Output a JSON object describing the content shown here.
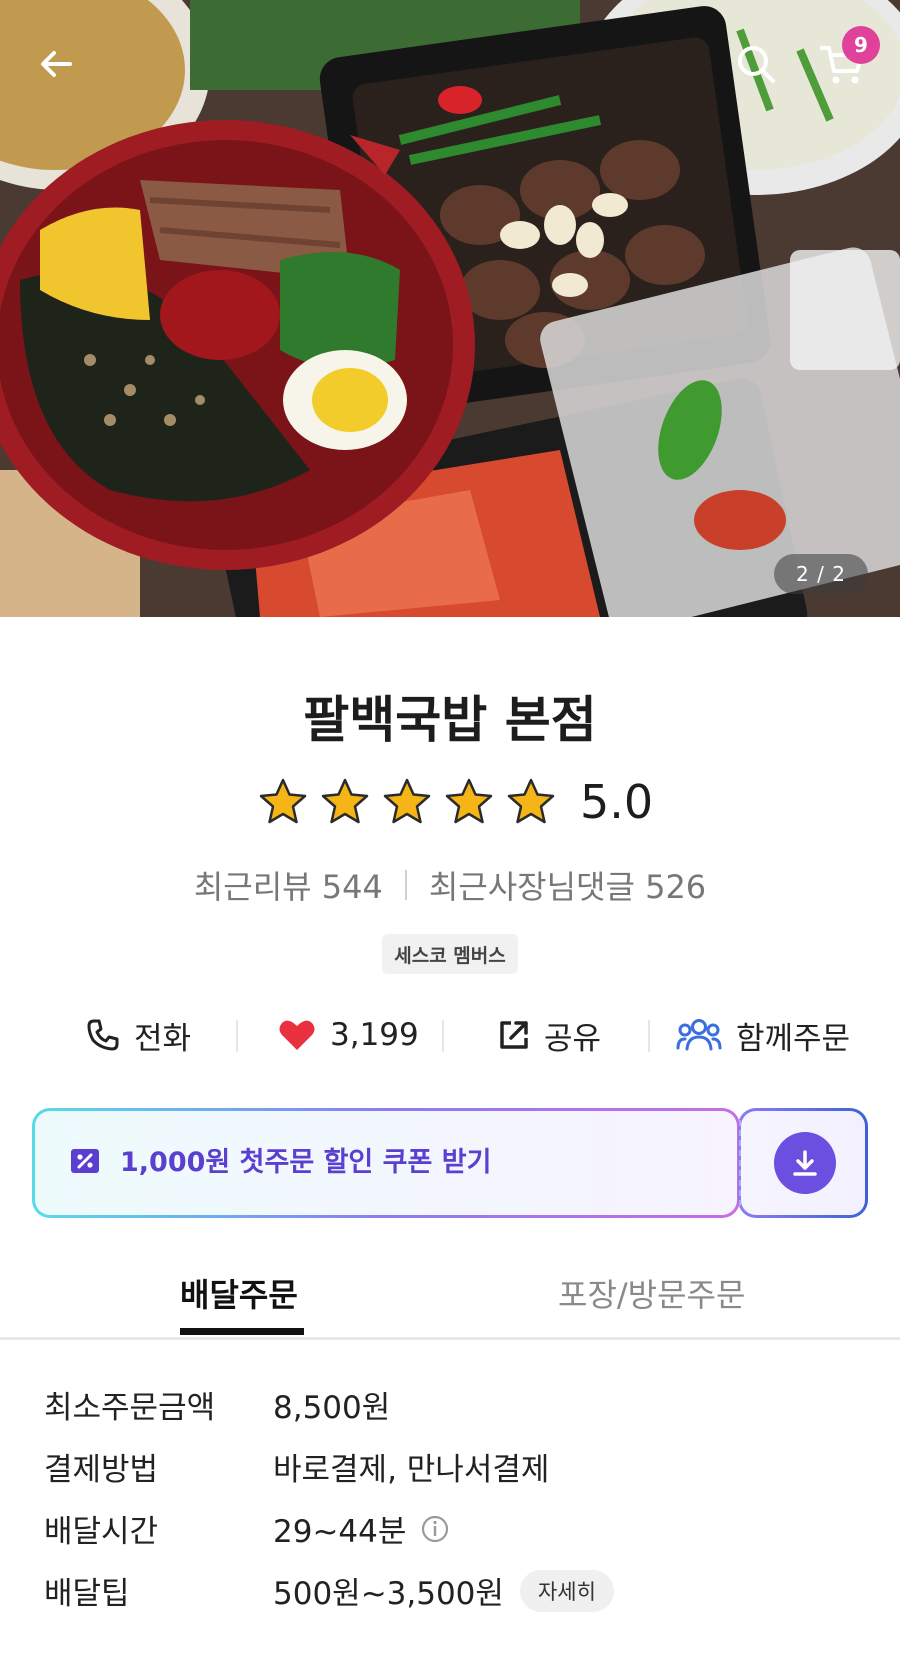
{
  "hero": {
    "cart_count": "9",
    "page_indicator": "2 / 2"
  },
  "store": {
    "name": "팔백국밥 본점",
    "rating": "5.0",
    "stars": 5,
    "recent_reviews": "최근리뷰 544",
    "owner_replies": "최근사장님댓글 526",
    "badge": "세스코 멤버스"
  },
  "actions": {
    "call": "전화",
    "likes": "3,199",
    "share": "공유",
    "group_order": "함께주문"
  },
  "coupon": {
    "text": "1,000원 첫주문 할인 쿠폰 받기"
  },
  "tabs": {
    "delivery": "배달주문",
    "pickup": "포장/방문주문"
  },
  "info": {
    "min_order_label": "최소주문금액",
    "min_order_value": "8,500원",
    "payment_label": "결제방법",
    "payment_value": "바로결제, 만나서결제",
    "delivery_time_label": "배달시간",
    "delivery_time_value": "29~44분",
    "delivery_tip_label": "배달팁",
    "delivery_tip_value": "500원~3,500원",
    "detail_label": "자세히"
  },
  "colors": {
    "accent": "#6a4fe0",
    "badge": "#e0419a",
    "heart": "#e8303f",
    "group_icon": "#3b6fe0"
  },
  "icons": {
    "back": "arrow-left-icon",
    "search": "search-icon",
    "cart": "cart-icon",
    "star": "star-icon",
    "phone": "phone-icon",
    "heart": "heart-icon",
    "share": "share-icon",
    "group": "group-icon",
    "coupon": "coupon-icon",
    "download": "download-icon",
    "info": "info-icon"
  }
}
